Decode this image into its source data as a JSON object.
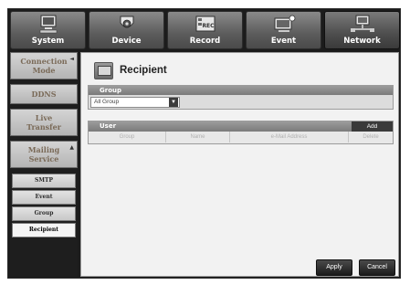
{
  "tabs": [
    {
      "label": "System",
      "icon": "system-monitor-icon"
    },
    {
      "label": "Device",
      "icon": "camera-icon"
    },
    {
      "label": "Record",
      "icon": "record-icon"
    },
    {
      "label": "Event",
      "icon": "event-icon"
    },
    {
      "label": "Network",
      "icon": "network-icon"
    }
  ],
  "tab_icon_text": {
    "record": "REC"
  },
  "sidebar": {
    "items": [
      {
        "label": "Connection Mode"
      },
      {
        "label": "DDNS"
      },
      {
        "label": "Live Transfer"
      },
      {
        "label": "Mailing Service"
      }
    ],
    "subitems": [
      {
        "label": "SMTP"
      },
      {
        "label": "Event"
      },
      {
        "label": "Group"
      },
      {
        "label": "Recipient"
      }
    ]
  },
  "page": {
    "title": "Recipient",
    "title_icon": "recipient-icon"
  },
  "group": {
    "header": "Group",
    "selected": "All Group"
  },
  "user": {
    "header": "User",
    "add_label": "Add",
    "columns": [
      "Group",
      "Name",
      "e-Mail Address",
      "Delete"
    ]
  },
  "actions": {
    "apply_label": "Apply",
    "cancel_label": "Cancel"
  },
  "colors": {
    "frame": "#1c1c1c",
    "panel": "#f2f2f2",
    "header": "#8a8a8a"
  }
}
